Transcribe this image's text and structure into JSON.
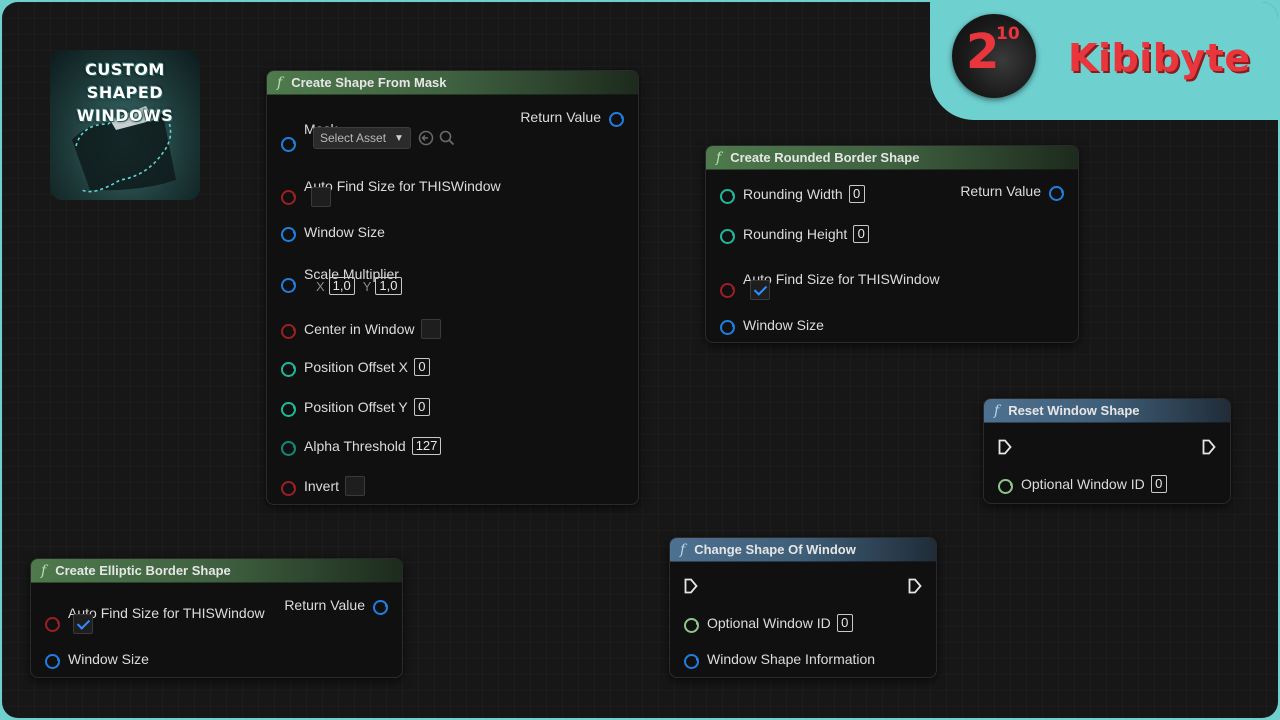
{
  "thumbnail": {
    "title_lines": [
      "CUSTOM",
      "SHAPED",
      "WINDOWS"
    ]
  },
  "brand": {
    "logo_base": "2",
    "logo_exponent": "10",
    "name": "Kibibyte"
  },
  "colors": {
    "canvas": "#171717",
    "frame": "#6fd0d0",
    "brand_text": "#e8363c",
    "header_green": "#4e7a4c",
    "header_blue": "#4d7190",
    "pin_blue": "#1f7fe0",
    "pin_red": "#9a1f26",
    "pin_teal": "#1fb89a",
    "pin_green": "#8fc78a"
  },
  "nodes": {
    "create_shape_from_mask": {
      "title": "Create Shape From Mask",
      "mask_label": "Mask",
      "select_asset": "Select Asset",
      "return_label": "Return Value",
      "auto_find_label": "Auto Find Size for THISWindow",
      "auto_find_checked": false,
      "window_size_label": "Window Size",
      "scale_label": "Scale Multiplier",
      "scale_x_label": "X",
      "scale_x": "1,0",
      "scale_y_label": "Y",
      "scale_y": "1,0",
      "center_label": "Center in Window",
      "center_checked": false,
      "pos_x_label": "Position Offset X",
      "pos_x": "0",
      "pos_y_label": "Position Offset Y",
      "pos_y": "0",
      "alpha_label": "Alpha Threshold",
      "alpha": "127",
      "invert_label": "Invert",
      "invert_checked": false
    },
    "create_rounded_border_shape": {
      "title": "Create Rounded Border Shape",
      "rounding_width_label": "Rounding Width",
      "rounding_width": "0",
      "rounding_height_label": "Rounding Height",
      "rounding_height": "0",
      "return_label": "Return Value",
      "auto_find_label": "Auto Find Size for THISWindow",
      "auto_find_checked": true,
      "window_size_label": "Window Size"
    },
    "reset_window_shape": {
      "title": "Reset Window Shape",
      "optional_id_label": "Optional Window ID",
      "optional_id": "0"
    },
    "create_elliptic_border_shape": {
      "title": "Create Elliptic Border Shape",
      "auto_find_label": "Auto Find Size for THISWindow",
      "auto_find_checked": true,
      "return_label": "Return Value",
      "window_size_label": "Window Size"
    },
    "change_shape_of_window": {
      "title": "Change Shape Of Window",
      "optional_id_label": "Optional Window ID",
      "optional_id": "0",
      "shape_info_label": "Window Shape Information"
    }
  }
}
